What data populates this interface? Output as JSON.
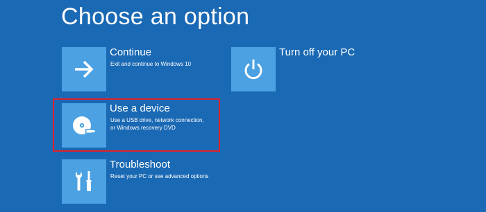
{
  "page": {
    "title": "Choose an option"
  },
  "options": [
    {
      "id": "continue",
      "icon": "arrow-right-icon",
      "title": "Continue",
      "description": [
        "Exit and continue to Windows 10"
      ]
    },
    {
      "id": "turn-off",
      "icon": "power-icon",
      "title": "Turn off your PC",
      "description": []
    },
    {
      "id": "use-device",
      "icon": "disc-usb-icon",
      "title": "Use a device",
      "description": [
        "Use a USB drive, network connection,",
        "or Windows recovery DVD"
      ]
    },
    {
      "id": "troubleshoot",
      "icon": "tools-icon",
      "title": "Troubleshoot",
      "description": [
        "Reset your PC or see advanced options"
      ]
    }
  ],
  "colors": {
    "background": "#1a69b4",
    "tile": "#4ba1e2",
    "text": "#ffffff",
    "highlight": "#e0202a"
  }
}
